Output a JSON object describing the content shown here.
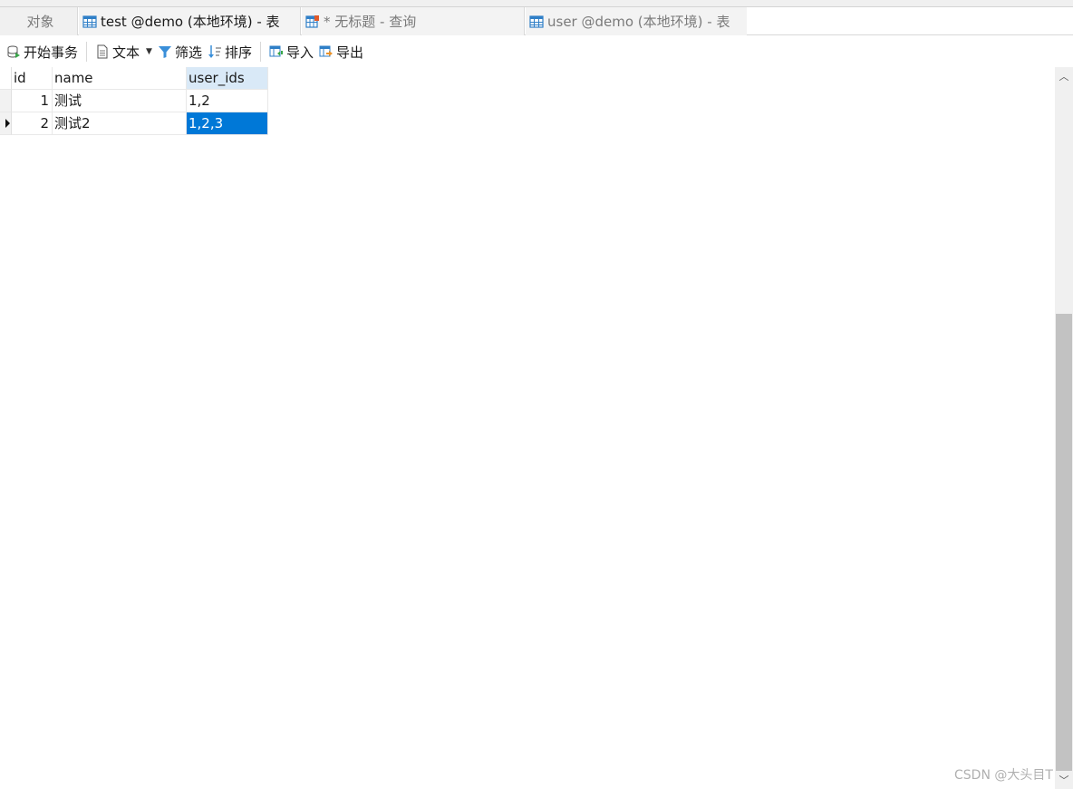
{
  "tabs": {
    "objects": "对象",
    "active": "test @demo (本地环境) - 表",
    "query": "* 无标题 - 查询",
    "user": "user @demo (本地环境) - 表"
  },
  "toolbar": {
    "begin_transaction": "开始事务",
    "text": "文本",
    "filter": "筛选",
    "sort": "排序",
    "import": "导入",
    "export": "导出"
  },
  "table": {
    "columns": [
      "id",
      "name",
      "user_ids"
    ],
    "rows": [
      {
        "id": "1",
        "name": "测试",
        "user_ids": "1,2"
      },
      {
        "id": "2",
        "name": "测试2",
        "user_ids": "1,2,3"
      }
    ],
    "selected_row": 2,
    "selected_column": "user_ids"
  },
  "colors": {
    "selection": "#0078d7",
    "header_highlight": "#d9e9f7"
  },
  "icons": [
    "table-icon",
    "query-icon",
    "transaction-icon",
    "text-icon",
    "filter-icon",
    "sort-icon",
    "import-icon",
    "export-icon",
    "row-indicator-icon",
    "scroll-up-icon",
    "scroll-down-icon"
  ],
  "watermark": "CSDN @大头目T"
}
